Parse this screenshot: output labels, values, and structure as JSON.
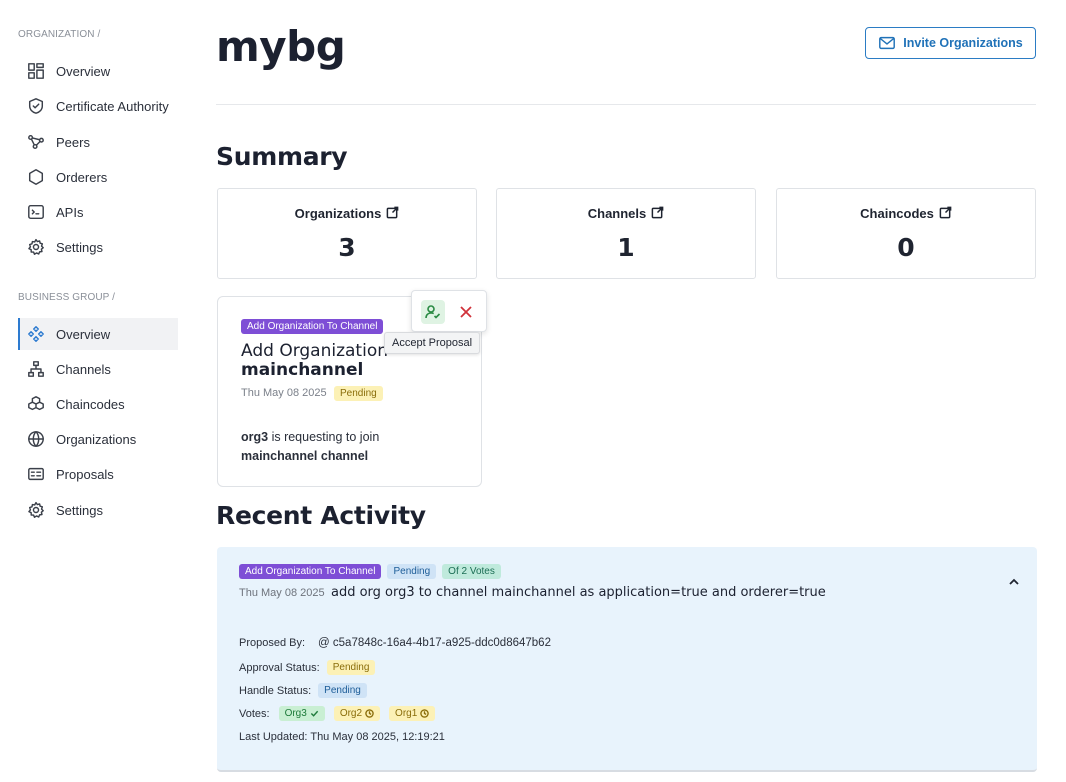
{
  "sidebar": {
    "org_section_label": "ORGANIZATION /",
    "org_items": [
      {
        "label": "Overview",
        "icon": "dashboard-icon"
      },
      {
        "label": "Certificate Authority",
        "icon": "shield-check-icon"
      },
      {
        "label": "Peers",
        "icon": "nodes-icon"
      },
      {
        "label": "Orderers",
        "icon": "hexagon-icon"
      },
      {
        "label": "APIs",
        "icon": "terminal-icon"
      },
      {
        "label": "Settings",
        "icon": "gear-icon"
      }
    ],
    "bg_section_label": "BUSINESS GROUP /",
    "bg_items": [
      {
        "label": "Overview",
        "icon": "diamond-nodes-icon",
        "active": true
      },
      {
        "label": "Channels",
        "icon": "hierarchy-icon"
      },
      {
        "label": "Chaincodes",
        "icon": "cubes-icon"
      },
      {
        "label": "Organizations",
        "icon": "globe-icon"
      },
      {
        "label": "Proposals",
        "icon": "id-card-icon"
      },
      {
        "label": "Settings",
        "icon": "gear-icon"
      }
    ]
  },
  "header": {
    "title": "mybg",
    "invite_label": "Invite Organizations"
  },
  "summary": {
    "heading": "Summary",
    "cards": [
      {
        "label": "Organizations",
        "value": "3"
      },
      {
        "label": "Channels",
        "value": "1"
      },
      {
        "label": "Chaincodes",
        "value": "0"
      }
    ]
  },
  "proposal_card": {
    "tag": "Add Organization To Channel",
    "title_line1": "Add Organization",
    "title_line2": "mainchannel",
    "date": "Thu May 08 2025",
    "status": "Pending",
    "desc_org": "org3",
    "desc_mid": " is requesting to join",
    "desc_channel": "mainchannel channel",
    "tooltip": "Accept Proposal"
  },
  "recent": {
    "heading": "Recent Activity",
    "tag_type": "Add Organization To Channel",
    "tag_status": "Pending",
    "tag_votes": "Of 2 Votes",
    "date": "Thu May 08 2025",
    "title": "add org org3 to channel mainchannel as application=true and orderer=true",
    "proposed_by_label": "Proposed By:",
    "proposed_by_value": "@ c5a7848c-16a4-4b17-a925-ddc0d8647b62",
    "approval_label": "Approval Status:",
    "approval_value": "Pending",
    "handle_label": "Handle Status:",
    "handle_value": "Pending",
    "votes_label": "Votes:",
    "votes": [
      {
        "org": "Org3",
        "state": "approved"
      },
      {
        "org": "Org2",
        "state": "pending"
      },
      {
        "org": "Org1",
        "state": "pending"
      }
    ],
    "last_updated": "Last Updated: Thu May 08 2025, 12:19:21"
  },
  "colors": {
    "accent": "#2d7bd0",
    "purple_tag": "#7e4ed6",
    "pending_bg": "#fcf1b6",
    "activity_bg": "#e8f3fc"
  }
}
